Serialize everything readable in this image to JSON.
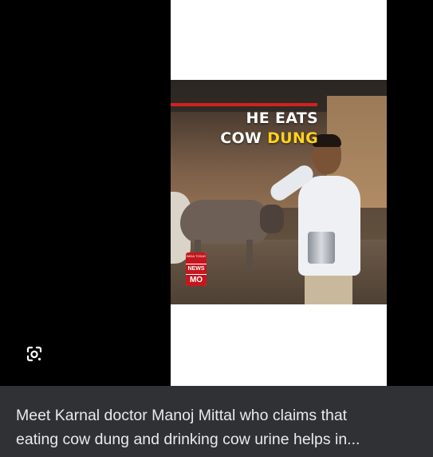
{
  "video": {
    "headline_line1": "HE EATS",
    "headline_line2_white": "COW ",
    "headline_line2_yellow": "DUNG",
    "logo_top": "INDIA TODAY",
    "logo_mid": "NEWS",
    "logo_bottom": "MO"
  },
  "lens": {
    "icon": "google-lens-icon"
  },
  "caption": {
    "line1": "Meet Karnal doctor Manoj Mittal who claims that",
    "line2": "eating cow dung and drinking cow urine helps in..."
  },
  "colors": {
    "background": "#000000",
    "caption_bg": "#303134",
    "caption_text": "#e8eaed",
    "headline_accent": "#ffd21e",
    "red_bar": "#d42020"
  }
}
